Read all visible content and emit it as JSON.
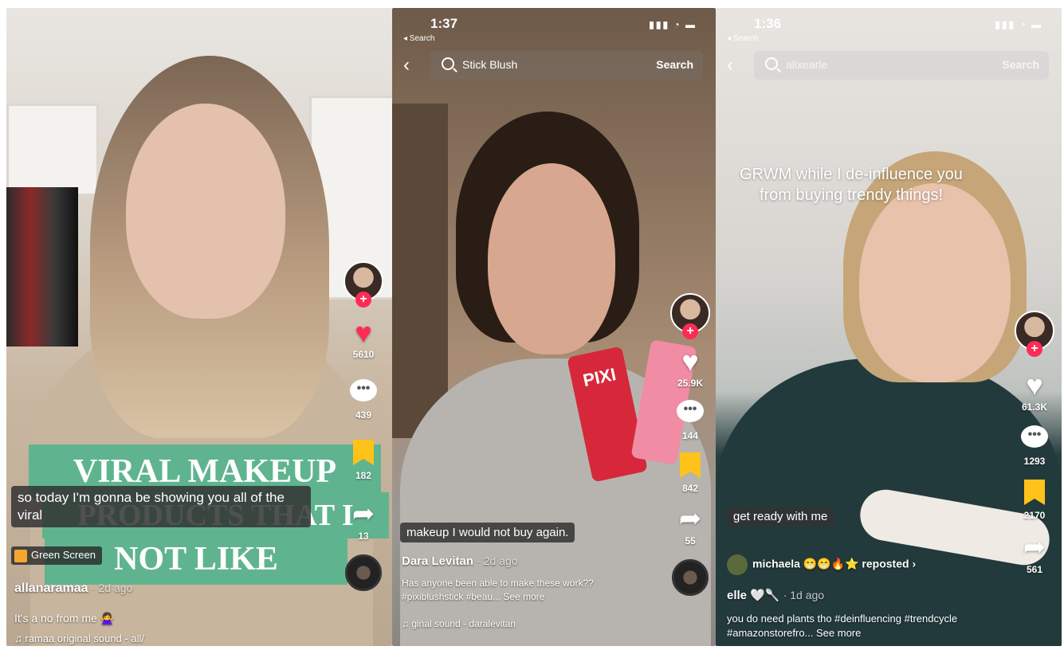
{
  "video1": {
    "banner_line1": "VIRAL MAKEUP",
    "banner_line2": "PRODUCTS THAT I",
    "banner_line3": "NOT LIKE",
    "caption": "so today I'm gonna be showing you all of the viral",
    "green_screen_label": "Green Screen",
    "username": "allanaramaa",
    "age": "· 2d ago",
    "description": "It's a no from me 🙅‍♀️",
    "sound": "ramaa    original sound - all/",
    "likes": "5610",
    "comments": "439",
    "saves": "182",
    "shares": "13"
  },
  "video2": {
    "time": "1:37",
    "back_app": "◂ Search",
    "search_query": "Stick Blush",
    "search_button": "Search",
    "caption": "makeup I would not buy again.",
    "username": "Dara Levitan",
    "age": "· 2d ago",
    "description": "Has anyone been able to make these work?? #pixiblushstick #beau... See more",
    "sound": "ginal sound - daralevitan",
    "likes": "25.9K",
    "comments": "144",
    "saves": "842",
    "shares": "55",
    "product_label": "PIXI"
  },
  "video3": {
    "time": "1:36",
    "back_app": "◂ Search",
    "search_query": "alixearle",
    "search_button": "Search",
    "overlay_text": "GRWM while I de-influence you from buying trendy things!",
    "caption": "get ready with me",
    "reposted": "michaela 😁😁🔥⭐ reposted ›",
    "username": "elle 🤍🥄",
    "age": "· 1d ago",
    "description": "you do need plants tho #deinfluencing #trendcycle #amazonstorefro... See more",
    "likes": "61.3K",
    "comments": "1293",
    "saves": "2170",
    "shares": "561"
  },
  "icons": {
    "heart": "♥",
    "comment": "•••",
    "share": "➦",
    "back_chevron": "‹",
    "note": "♫",
    "signal": "▮▮▮ ◔ ▬"
  },
  "colors": {
    "tiktok_red": "#fe2c55",
    "save_yellow": "#ffc21a",
    "banner_green": "#5fb48f"
  }
}
